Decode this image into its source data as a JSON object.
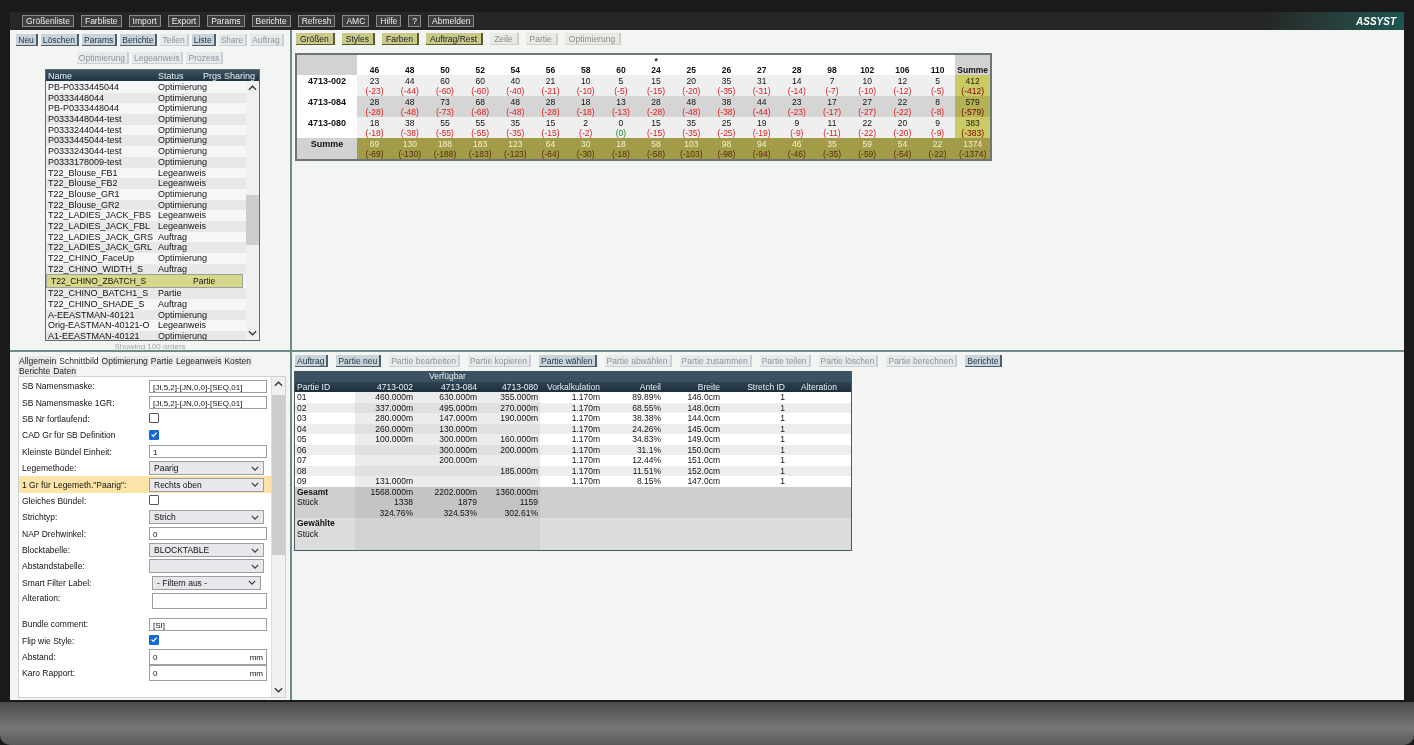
{
  "menu": [
    "Größenliste",
    "Farbliste",
    "Import",
    "Export",
    "Params",
    "Berichte",
    "Refresh",
    "AMC",
    "Hilfe",
    "?",
    "Abmelden"
  ],
  "logo": "ASSYST",
  "orders": {
    "buttons": [
      {
        "label": "Neu",
        "disabled": false
      },
      {
        "label": "Löschen",
        "disabled": false
      },
      {
        "label": "Params",
        "disabled": false
      },
      {
        "label": "Berichte",
        "disabled": false
      },
      {
        "label": "Teilen",
        "disabled": true
      },
      {
        "label": "Liste",
        "disabled": false
      },
      {
        "label": "Share",
        "disabled": true
      },
      {
        "label": "Auftrag",
        "disabled": true
      }
    ],
    "buttons_row_2": [
      {
        "label": "Optimierung",
        "disabled": true
      },
      {
        "label": "Legeanweis",
        "disabled": true
      },
      {
        "label": "Prozess",
        "disabled": true
      }
    ],
    "columns": [
      "Name",
      "Status",
      "Prgs Sharing"
    ],
    "rows": [
      {
        "name": "PB-P0333445044",
        "status": "Optimierung",
        "selected": false
      },
      {
        "name": "P0333448044",
        "status": "Optimierung",
        "selected": false
      },
      {
        "name": "PB-P0333448044",
        "status": "Optimierung",
        "selected": false
      },
      {
        "name": "P0333448044-test",
        "status": "Optimierung",
        "selected": false
      },
      {
        "name": "P0333244044-test",
        "status": "Optimierung",
        "selected": false
      },
      {
        "name": "P0333445044-test",
        "status": "Optimierung",
        "selected": false
      },
      {
        "name": "P0333243044-test",
        "status": "Optimierung",
        "selected": false
      },
      {
        "name": "P0333178009-test",
        "status": "Optimierung",
        "selected": false
      },
      {
        "name": "T22_Blouse_FB1",
        "status": "Legeanweis",
        "selected": false
      },
      {
        "name": "T22_Blouse_FB2",
        "status": "Legeanweis",
        "selected": false
      },
      {
        "name": "T22_Blouse_GR1",
        "status": "Optimierung",
        "selected": false
      },
      {
        "name": "T22_Blouse_GR2",
        "status": "Optimierung",
        "selected": false
      },
      {
        "name": "T22_LADIES_JACK_FBS",
        "status": "Legeanweis",
        "selected": false
      },
      {
        "name": "T22_LADIES_JACK_FBL",
        "status": "Legeanweis",
        "selected": false
      },
      {
        "name": "T22_LADIES_JACK_GRS",
        "status": "Auftrag",
        "selected": false
      },
      {
        "name": "T22_LADIES_JACK_GRL",
        "status": "Auftrag",
        "selected": false
      },
      {
        "name": "T22_CHINO_FaceUp",
        "status": "Optimierung",
        "selected": false
      },
      {
        "name": "T22_CHINO_WIDTH_S",
        "status": "Auftrag",
        "selected": false
      },
      {
        "name": "T22_CHINO_ZBATCH_S",
        "status": "Partie",
        "selected": true
      },
      {
        "name": "T22_CHINO_BATCH1_S",
        "status": "Partie",
        "selected": false
      },
      {
        "name": "T22_CHINO_SHADE_S",
        "status": "Auftrag",
        "selected": false
      },
      {
        "name": "A-EEASTMAN-40121",
        "status": "Optimierung",
        "selected": false
      },
      {
        "name": "Orig-EASTMAN-40121-O",
        "status": "Legeanweis",
        "selected": false
      },
      {
        "name": "A1-EEASTMAN-40121",
        "status": "Optimierung",
        "selected": false
      }
    ],
    "footer": "Showing 100 orders"
  },
  "grid": {
    "buttons": [
      {
        "label": "Größen",
        "disabled": false
      },
      {
        "label": "Styles",
        "disabled": false
      },
      {
        "label": "Farben",
        "disabled": false
      },
      {
        "label": "Auftrag/Rest",
        "disabled": false
      },
      {
        "label": "Zeile",
        "disabled": true
      },
      {
        "label": "Partie",
        "disabled": true
      },
      {
        "label": "Optimierung",
        "disabled": true
      }
    ],
    "sizes": [
      {
        "size": "46"
      },
      {
        "size": "48"
      },
      {
        "size": "50"
      },
      {
        "size": "52"
      },
      {
        "size": "54"
      },
      {
        "size": "56"
      },
      {
        "size": "58"
      },
      {
        "size": "60"
      },
      {
        "size": "24",
        "note": "*"
      },
      {
        "size": "25"
      },
      {
        "size": "26"
      },
      {
        "size": "27"
      },
      {
        "size": "28"
      },
      {
        "size": "98"
      },
      {
        "size": "102"
      },
      {
        "size": "106"
      },
      {
        "size": "110"
      }
    ],
    "total_label": "Summe",
    "rows": [
      {
        "label": "4713-002",
        "kind": "color",
        "total": {
          "q": "412",
          "r": "(-412)"
        },
        "cells": [
          {
            "q": "23",
            "r": "(-23)",
            "ok": false
          },
          {
            "q": "44",
            "r": "(-44)",
            "ok": false
          },
          {
            "q": "60",
            "r": "(-60)",
            "ok": false
          },
          {
            "q": "60",
            "r": "(-60)",
            "ok": false
          },
          {
            "q": "40",
            "r": "(-40)",
            "ok": false
          },
          {
            "q": "21",
            "r": "(-21)",
            "ok": false
          },
          {
            "q": "10",
            "r": "(-10)",
            "ok": false
          },
          {
            "q": "5",
            "r": "(-5)",
            "ok": false
          },
          {
            "q": "15",
            "r": "(-15)",
            "ok": false
          },
          {
            "q": "20",
            "r": "(-20)",
            "ok": false
          },
          {
            "q": "35",
            "r": "(-35)",
            "ok": false
          },
          {
            "q": "31",
            "r": "(-31)",
            "ok": false
          },
          {
            "q": "14",
            "r": "(-14)",
            "ok": false
          },
          {
            "q": "7",
            "r": "(-7)",
            "ok": false
          },
          {
            "q": "10",
            "r": "(-10)",
            "ok": false
          },
          {
            "q": "12",
            "r": "(-12)",
            "ok": false
          },
          {
            "q": "5",
            "r": "(-5)",
            "ok": false
          }
        ]
      },
      {
        "label": "4713-084",
        "kind": "color",
        "total": {
          "q": "579",
          "r": "(-579)"
        },
        "cells": [
          {
            "q": "28",
            "r": "(-28)",
            "ok": false
          },
          {
            "q": "48",
            "r": "(-48)",
            "ok": false
          },
          {
            "q": "73",
            "r": "(-73)",
            "ok": false
          },
          {
            "q": "68",
            "r": "(-68)",
            "ok": false
          },
          {
            "q": "48",
            "r": "(-48)",
            "ok": false
          },
          {
            "q": "28",
            "r": "(-28)",
            "ok": false
          },
          {
            "q": "18",
            "r": "(-18)",
            "ok": false
          },
          {
            "q": "13",
            "r": "(-13)",
            "ok": false
          },
          {
            "q": "28",
            "r": "(-28)",
            "ok": false
          },
          {
            "q": "48",
            "r": "(-48)",
            "ok": false
          },
          {
            "q": "38",
            "r": "(-38)",
            "ok": false
          },
          {
            "q": "44",
            "r": "(-44)",
            "ok": false
          },
          {
            "q": "23",
            "r": "(-23)",
            "ok": false
          },
          {
            "q": "17",
            "r": "(-17)",
            "ok": false
          },
          {
            "q": "27",
            "r": "(-27)",
            "ok": false
          },
          {
            "q": "22",
            "r": "(-22)",
            "ok": false
          },
          {
            "q": "8",
            "r": "(-8)",
            "ok": false
          }
        ]
      },
      {
        "label": "4713-080",
        "kind": "color",
        "total": {
          "q": "383",
          "r": "(-383)"
        },
        "cells": [
          {
            "q": "18",
            "r": "(-18)",
            "ok": false
          },
          {
            "q": "38",
            "r": "(-38)",
            "ok": false
          },
          {
            "q": "55",
            "r": "(-55)",
            "ok": false
          },
          {
            "q": "55",
            "r": "(-55)",
            "ok": false
          },
          {
            "q": "35",
            "r": "(-35)",
            "ok": false
          },
          {
            "q": "15",
            "r": "(-15)",
            "ok": false
          },
          {
            "q": "2",
            "r": "(-2)",
            "ok": false
          },
          {
            "q": "0",
            "r": "(0)",
            "ok": true
          },
          {
            "q": "15",
            "r": "(-15)",
            "ok": false
          },
          {
            "q": "35",
            "r": "(-35)",
            "ok": false
          },
          {
            "q": "25",
            "r": "(-25)",
            "ok": false
          },
          {
            "q": "19",
            "r": "(-19)",
            "ok": false
          },
          {
            "q": "9",
            "r": "(-9)",
            "ok": false
          },
          {
            "q": "11",
            "r": "(-11)",
            "ok": false
          },
          {
            "q": "22",
            "r": "(-22)",
            "ok": false
          },
          {
            "q": "20",
            "r": "(-20)",
            "ok": false
          },
          {
            "q": "9",
            "r": "(-9)",
            "ok": false
          }
        ]
      },
      {
        "label": "Summe",
        "kind": "sum",
        "total": {
          "q": "1374",
          "r": "(-1374)"
        },
        "cells": [
          {
            "q": "69",
            "r": "(-69)",
            "ok": false
          },
          {
            "q": "130",
            "r": "(-130)",
            "ok": false
          },
          {
            "q": "188",
            "r": "(-188)",
            "ok": false
          },
          {
            "q": "183",
            "r": "(-183)",
            "ok": false
          },
          {
            "q": "123",
            "r": "(-123)",
            "ok": false
          },
          {
            "q": "64",
            "r": "(-64)",
            "ok": false
          },
          {
            "q": "30",
            "r": "(-30)",
            "ok": false
          },
          {
            "q": "18",
            "r": "(-18)",
            "ok": false
          },
          {
            "q": "58",
            "r": "(-58)",
            "ok": false
          },
          {
            "q": "103",
            "r": "(-103)",
            "ok": false
          },
          {
            "q": "98",
            "r": "(-98)",
            "ok": false
          },
          {
            "q": "94",
            "r": "(-94)",
            "ok": false
          },
          {
            "q": "46",
            "r": "(-46)",
            "ok": false
          },
          {
            "q": "35",
            "r": "(-35)",
            "ok": false
          },
          {
            "q": "59",
            "r": "(-59)",
            "ok": false
          },
          {
            "q": "54",
            "r": "(-54)",
            "ok": false
          },
          {
            "q": "22",
            "r": "(-22)",
            "ok": false
          }
        ]
      }
    ]
  },
  "settings": {
    "tabs": [
      {
        "label": "Allgemein",
        "selected": false
      },
      {
        "label": "Schnittbild",
        "selected": true
      },
      {
        "label": "Optimierung",
        "selected": false
      },
      {
        "label": "Partie",
        "selected": false
      },
      {
        "label": "Legeanweis",
        "selected": false
      },
      {
        "label": "Kosten",
        "selected": false
      },
      {
        "label": "Berichte",
        "selected": false
      },
      {
        "label": "Daten",
        "selected": false
      }
    ],
    "fields": [
      {
        "label": "SB Namensmaske:",
        "kind": "text",
        "value": "[JI,5,2]-[JN,0,0]-[SEQ,01]",
        "highlighted": false
      },
      {
        "label": "SB Namensmaske 1GR:",
        "kind": "text",
        "value": "[JI,5,2]-[JN,0,0]-[SEQ,01]",
        "highlighted": false
      },
      {
        "label": "SB Nr fortlaufend:",
        "kind": "checkbox",
        "checked": false,
        "highlighted": false
      },
      {
        "label": "CAD Gr für SB Definition",
        "kind": "checkbox",
        "checked": true,
        "highlighted": false
      },
      {
        "label": "Kleinste Bündel Einheit:",
        "kind": "text",
        "value": "1",
        "highlighted": false
      },
      {
        "label": "Legemethode:",
        "kind": "select",
        "value": "Paarig",
        "highlighted": false
      },
      {
        "label": "1 Gr für Legemeth.\"Paarig\":",
        "kind": "select",
        "value": "Rechts oben",
        "highlighted": true
      },
      {
        "label": "Gleiches Bündel:",
        "kind": "checkbox",
        "checked": false,
        "highlighted": false
      },
      {
        "label": "Strichtyp:",
        "kind": "select",
        "value": "Strich",
        "highlighted": false
      },
      {
        "label": "NAP Drehwinkel:",
        "kind": "text",
        "value": "0",
        "highlighted": false
      },
      {
        "label": "Blocktabelle:",
        "kind": "select",
        "value": "BLOCKTABLE",
        "highlighted": false
      },
      {
        "label": "Abstandstabelle:",
        "kind": "select",
        "highlighted": false
      },
      {
        "label": "Smart Filter Label:",
        "kind": "filter",
        "value": "- Filtern aus -",
        "highlighted": false
      },
      {
        "label": "Alteration:",
        "kind": "tall",
        "highlighted": false
      },
      {
        "label": "Bundle comment:",
        "kind": "text",
        "value": "[SI]",
        "highlighted": false
      },
      {
        "label": "Flip wie Style:",
        "kind": "checkbox",
        "checked": true,
        "highlighted": false
      },
      {
        "label": "Abstand:",
        "kind": "unit",
        "value": "0",
        "unit": "mm",
        "highlighted": false
      },
      {
        "label": "Karo Rapport:",
        "kind": "unit",
        "value": "0",
        "unit": "mm",
        "highlighted": false
      }
    ]
  },
  "batches": {
    "buttons": [
      {
        "label": "Auftrag",
        "disabled": false
      },
      {
        "label": "Partie neu",
        "disabled": false
      },
      {
        "label": "Partie bearbeiten",
        "disabled": true
      },
      {
        "label": "Partie kopieren",
        "disabled": true
      },
      {
        "label": "Partie wählen",
        "disabled": false
      },
      {
        "label": "Partie abwählen",
        "disabled": true
      },
      {
        "label": "Partie zusammen",
        "disabled": true
      },
      {
        "label": "Partie teilen",
        "disabled": true
      },
      {
        "label": "Partie löschen",
        "disabled": true
      },
      {
        "label": "Partie berechnen",
        "disabled": true
      },
      {
        "label": "Berichte",
        "disabled": false
      }
    ],
    "group_label": "Verfügbar",
    "columns": [
      "Partie ID",
      "4713-002",
      "4713-084",
      "4713-080",
      "Vorkalkulation",
      "Anteil",
      "Breite",
      "Stretch ID",
      "Alteration"
    ],
    "rows": [
      {
        "id": "01",
        "avail_1": "460.000m",
        "avail_2": "630.000m",
        "avail_3": "355.000m",
        "vorkalkulation": "1.170m",
        "anteil": "89.89%",
        "breite": "146.0cm",
        "stretch_id": "1"
      },
      {
        "id": "02",
        "avail_1": "337.000m",
        "avail_2": "495.000m",
        "avail_3": "270.000m",
        "vorkalkulation": "1.170m",
        "anteil": "68.55%",
        "breite": "148.0cm",
        "stretch_id": "1"
      },
      {
        "id": "03",
        "avail_1": "280.000m",
        "avail_2": "147.000m",
        "avail_3": "190.000m",
        "vorkalkulation": "1.170m",
        "anteil": "38.38%",
        "breite": "144.0cm",
        "stretch_id": "1"
      },
      {
        "id": "04",
        "avail_1": "260.000m",
        "avail_2": "130.000m",
        "vorkalkulation": "1.170m",
        "anteil": "24.26%",
        "breite": "145.0cm",
        "stretch_id": "1"
      },
      {
        "id": "05",
        "avail_1": "100.000m",
        "avail_2": "300.000m",
        "avail_3": "160.000m",
        "vorkalkulation": "1.170m",
        "anteil": "34.83%",
        "breite": "149.0cm",
        "stretch_id": "1"
      },
      {
        "id": "06",
        "avail_2": "300.000m",
        "avail_3": "200.000m",
        "vorkalkulation": "1.170m",
        "anteil": "31.1%",
        "breite": "150.0cm",
        "stretch_id": "1"
      },
      {
        "id": "07",
        "avail_2": "200.000m",
        "vorkalkulation": "1.170m",
        "anteil": "12.44%",
        "breite": "151.0cm",
        "stretch_id": "1"
      },
      {
        "id": "08",
        "avail_3": "185.000m",
        "vorkalkulation": "1.170m",
        "anteil": "11.51%",
        "breite": "152.0cm",
        "stretch_id": "1"
      },
      {
        "id": "09",
        "avail_1": "131.000m",
        "vorkalkulation": "1.170m",
        "anteil": "8.15%",
        "breite": "147.0cm",
        "stretch_id": "1"
      }
    ],
    "totals": [
      {
        "label": "Gesamt",
        "values": [
          "1568.000m",
          "2202.000m",
          "1360.000m"
        ]
      },
      {
        "label": "Stück",
        "values": [
          "1338",
          "1879",
          "1159"
        ]
      },
      {
        "values": [
          "324.76%",
          "324.53%",
          "302.61%"
        ]
      }
    ],
    "chosen": [
      "Gewählte",
      "Stück"
    ]
  }
}
